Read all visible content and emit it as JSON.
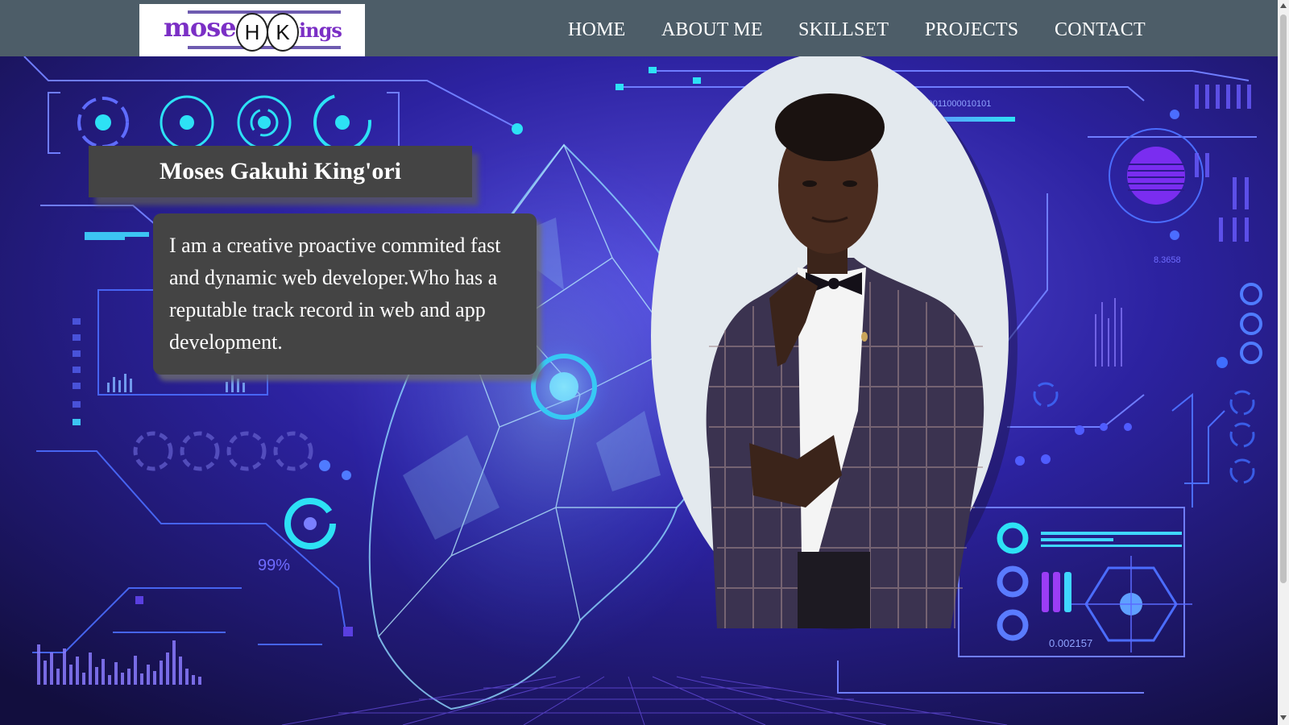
{
  "nav": {
    "logo": {
      "part1": "mose",
      "letter1": "H",
      "letter2": "K",
      "part2": "ings"
    },
    "links": [
      "HOME",
      "ABOUT ME",
      "SKILLSET",
      "PROJECTS",
      "CONTACT"
    ]
  },
  "hero": {
    "name": "Moses Gakuhi King'ori",
    "bio": "I am a creative proactive commited fast and dynamic web developer.Who has a reputable track record in web and app development.",
    "background_labels": {
      "percent": "99%",
      "number": "0.002157",
      "binary": "01100011000010101",
      "mirrored": "8.3658"
    }
  },
  "colors": {
    "nav_bg": "#4d5d68",
    "card_bg": "#444444",
    "scene_bg": "#1b1650",
    "accent_cyan": "#2de1f5",
    "accent_purple": "#7b2fc5"
  }
}
